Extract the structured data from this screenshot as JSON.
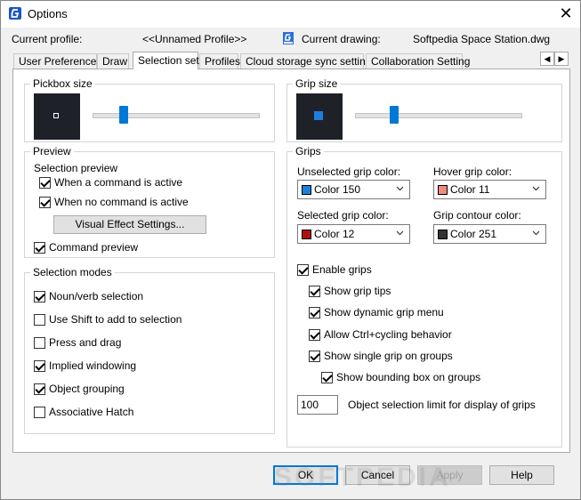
{
  "window": {
    "title": "Options",
    "close_glyph": "✕"
  },
  "header": {
    "current_profile_label": "Current profile:",
    "current_profile_value": "<<Unnamed Profile>>",
    "current_drawing_label": "Current drawing:",
    "current_drawing_value": "Softpedia Space Station.dwg"
  },
  "tabs": [
    {
      "label": "User Preferences"
    },
    {
      "label": "Draw"
    },
    {
      "label": "Selection set"
    },
    {
      "label": "Profiles"
    },
    {
      "label": "Cloud storage sync settings"
    },
    {
      "label": "Collaboration Setting"
    }
  ],
  "tab_scroll": {
    "left": "◀",
    "right": "▶"
  },
  "pickbox": {
    "label": "Pickbox size",
    "slider_fraction": 0.17
  },
  "gripsize": {
    "label": "Grip size",
    "slider_fraction": 0.22
  },
  "preview": {
    "label": "Preview",
    "selection_preview_label": "Selection preview",
    "when_active": "When a command is active",
    "when_no_command": "When no command is active",
    "visual_effect_button": "Visual Effect Settings...",
    "command_preview": "Command preview"
  },
  "selection_modes": {
    "label": "Selection modes",
    "items": [
      {
        "label": "Noun/verb selection",
        "checked": true
      },
      {
        "label": "Use Shift to add to selection",
        "checked": false
      },
      {
        "label": "Press and drag",
        "checked": false
      },
      {
        "label": "Implied windowing",
        "checked": true
      },
      {
        "label": "Object grouping",
        "checked": true
      },
      {
        "label": "Associative Hatch",
        "checked": false
      }
    ]
  },
  "grips": {
    "label": "Grips",
    "unselected_label": "Unselected grip color:",
    "unselected_value": "Color 150",
    "unselected_color": "#1e7ee0",
    "hover_label": "Hover grip color:",
    "hover_value": "Color 11",
    "hover_color": "#f28a80",
    "selected_label": "Selected grip color:",
    "selected_value": "Color 12",
    "selected_color": "#b01010",
    "contour_label": "Grip contour color:",
    "contour_value": "Color 251",
    "contour_color": "#333333",
    "enable_grips": "Enable grips",
    "show_grip_tips": "Show grip tips",
    "show_dynamic_menu": "Show dynamic grip menu",
    "allow_ctrl_cycling": "Allow Ctrl+cycling behavior",
    "show_single_grip": "Show single grip on groups",
    "show_bounding_box": "Show bounding box on groups",
    "object_limit_value": "100",
    "object_limit_label": "Object selection limit for display of grips"
  },
  "footer": {
    "ok": "OK",
    "cancel": "Cancel",
    "apply": "Apply",
    "help": "Help"
  },
  "watermark": "SOFTPEDIA",
  "colors": {
    "accent": "#0078d7",
    "preview_bg": "#1e2127",
    "grip_blue": "#1e7ee0"
  }
}
